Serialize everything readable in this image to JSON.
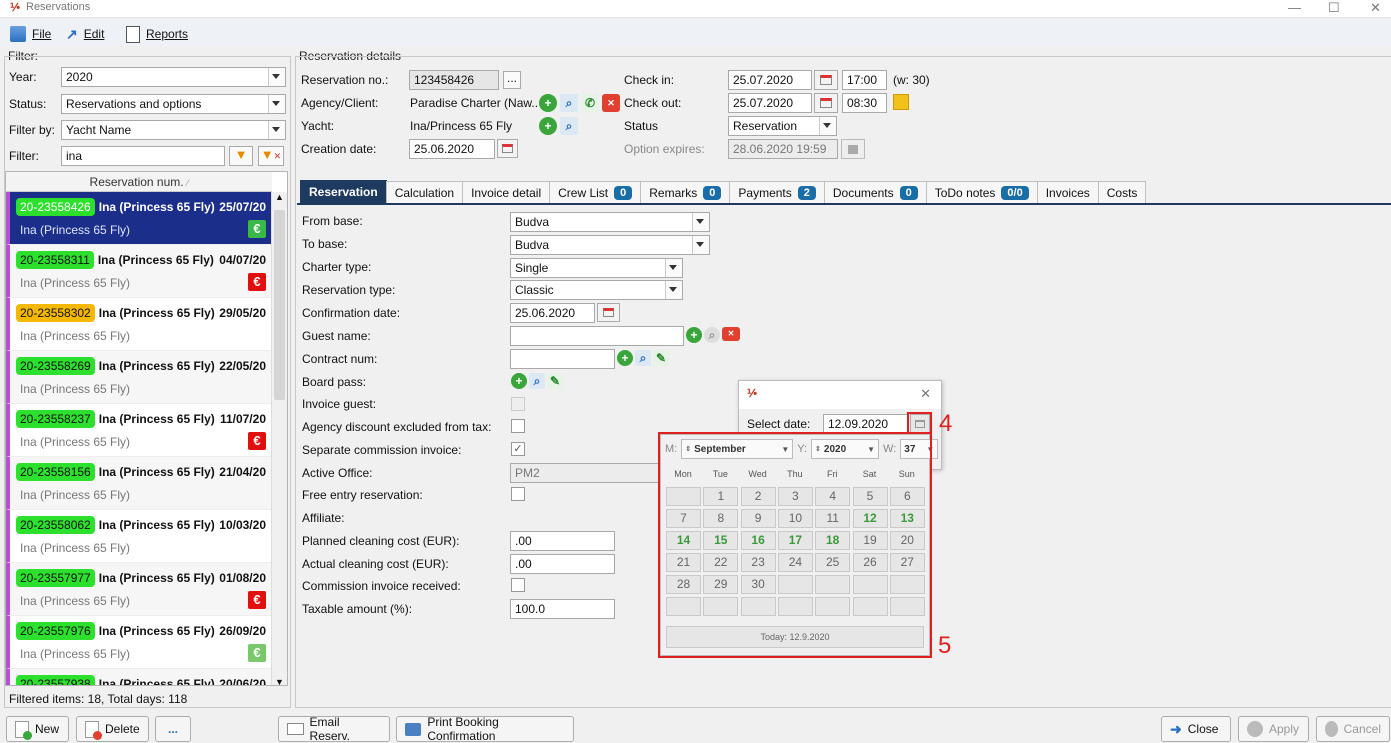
{
  "window": {
    "title": "Reservations"
  },
  "menu": {
    "file": "File",
    "edit": "Edit",
    "reports": "Reports"
  },
  "filter": {
    "group": "Filter:",
    "year_label": "Year:",
    "year": "2020",
    "status_label": "Status:",
    "status": "Reservations and options",
    "filterby_label": "Filter by:",
    "filterby": "Yacht Name",
    "filter_label": "Filter:",
    "filter_value": "ina",
    "column": "Reservation num.",
    "footer": "Filtered items: 18, Total days: 118"
  },
  "reservations": [
    {
      "num": "20-23558426",
      "yacht": "Ina (Princess 65 Fly)",
      "date": "25/07/20",
      "sub": "Ina (Princess 65 Fly)",
      "tag": "green",
      "pay": "€",
      "paycolor": "#3bb84a",
      "selected": true
    },
    {
      "num": "20-23558311",
      "yacht": "Ina (Princess 65 Fly)",
      "date": "04/07/20",
      "sub": "Ina (Princess 65 Fly)",
      "tag": "green",
      "pay": "€",
      "paycolor": "#e01010"
    },
    {
      "num": "20-23558302",
      "yacht": "Ina (Princess 65 Fly)",
      "date": "29/05/20",
      "sub": "Ina (Princess 65 Fly)",
      "tag": "orange",
      "pay": "",
      "paycolor": ""
    },
    {
      "num": "20-23558269",
      "yacht": "Ina (Princess 65 Fly)",
      "date": "22/05/20",
      "sub": "Ina (Princess 65 Fly)",
      "tag": "green",
      "pay": "",
      "paycolor": ""
    },
    {
      "num": "20-23558237",
      "yacht": "Ina (Princess 65 Fly)",
      "date": "11/07/20",
      "sub": "Ina (Princess 65 Fly)",
      "tag": "green",
      "pay": "€",
      "paycolor": "#e01010"
    },
    {
      "num": "20-23558156",
      "yacht": "Ina (Princess 65 Fly)",
      "date": "21/04/20",
      "sub": "Ina (Princess 65 Fly)",
      "tag": "green",
      "pay": "",
      "paycolor": ""
    },
    {
      "num": "20-23558062",
      "yacht": "Ina (Princess 65 Fly)",
      "date": "10/03/20",
      "sub": "Ina (Princess 65 Fly)",
      "tag": "green",
      "pay": "",
      "paycolor": ""
    },
    {
      "num": "20-23557977",
      "yacht": "Ina (Princess 65 Fly)",
      "date": "01/08/20",
      "sub": "Ina (Princess 65 Fly)",
      "tag": "green",
      "pay": "€",
      "paycolor": "#e01010"
    },
    {
      "num": "20-23557976",
      "yacht": "Ina (Princess 65 Fly)",
      "date": "26/09/20",
      "sub": "Ina (Princess 65 Fly)",
      "tag": "green",
      "pay": "€",
      "paycolor": "#7bc86c"
    },
    {
      "num": "20-23557938",
      "yacht": "Ina (Princess 65 Fly)",
      "date": "20/06/20",
      "sub": "",
      "tag": "green",
      "pay": "",
      "paycolor": ""
    }
  ],
  "details": {
    "group": "Reservation details",
    "resno_label": "Reservation no.:",
    "resno": "123458426",
    "agency_label": "Agency/Client:",
    "agency": "Paradise Charter (Naw...",
    "yacht_label": "Yacht:",
    "yacht": "Ina/Princess 65 Fly",
    "creation_label": "Creation date:",
    "creation": "25.06.2020",
    "checkin_label": "Check in:",
    "checkin_date": "25.07.2020",
    "checkin_time": "17:00",
    "week": "(w: 30)",
    "checkout_label": "Check out:",
    "checkout_date": "25.07.2020",
    "checkout_time": "08:30",
    "status_label": "Status",
    "status": "Reservation",
    "option_label": "Option expires:",
    "option": "28.06.2020 19:59"
  },
  "tabs": [
    {
      "label": "Reservation"
    },
    {
      "label": "Calculation"
    },
    {
      "label": "Invoice detail"
    },
    {
      "label": "Crew List",
      "badge": "0"
    },
    {
      "label": "Remarks",
      "badge": "0"
    },
    {
      "label": "Payments",
      "badge": "2"
    },
    {
      "label": "Documents",
      "badge": "0"
    },
    {
      "label": "ToDo notes",
      "badge": "0/0"
    },
    {
      "label": "Invoices"
    },
    {
      "label": "Costs"
    }
  ],
  "form": {
    "from_base_label": "From base:",
    "from_base": "Budva",
    "to_base_label": "To base:",
    "to_base": "Budva",
    "charter_label": "Charter type:",
    "charter": "Single",
    "restype_label": "Reservation type:",
    "restype": "Classic",
    "confdate_label": "Confirmation date:",
    "confdate": "25.06.2020",
    "guest_label": "Guest name:",
    "contract_label": "Contract num:",
    "board_label": "Board pass:",
    "invguest_label": "Invoice guest:",
    "agency_disc_label": "Agency discount excluded from tax:",
    "sep_comm_label": "Separate commission invoice:",
    "office_label": "Active Office:",
    "office": "PM2",
    "free_label": "Free entry reservation:",
    "affiliate_label": "Affiliate:",
    "planned_label": "Planned cleaning cost (EUR):",
    "planned": ".00",
    "actual_label": "Actual cleaning cost (EUR):",
    "actual": ".00",
    "comm_recv_label": "Commission invoice received:",
    "taxable_label": "Taxable amount (%):",
    "taxable": "100.0"
  },
  "dialog": {
    "select_label": "Select date:",
    "select_value": "12.09.2020"
  },
  "calendar": {
    "m_label": "M:",
    "month": "September",
    "y_label": "Y:",
    "year": "2020",
    "w_label": "W:",
    "week": "37",
    "daynames": [
      "Mon",
      "Tue",
      "Wed",
      "Thu",
      "Fri",
      "Sat",
      "Sun"
    ],
    "rows": [
      [
        "",
        "1",
        "2",
        "3",
        "4",
        "5",
        "6"
      ],
      [
        "7",
        "8",
        "9",
        "10",
        "11",
        "12",
        "13"
      ],
      [
        "14",
        "15",
        "16",
        "17",
        "18",
        "19",
        "20"
      ],
      [
        "21",
        "22",
        "23",
        "24",
        "25",
        "26",
        "27"
      ],
      [
        "28",
        "29",
        "30",
        "",
        "",
        "",
        ""
      ],
      [
        "",
        "",
        "",
        "",
        "",
        "",
        ""
      ]
    ],
    "highlight": [
      "12",
      "13",
      "14",
      "15",
      "16",
      "17",
      "18"
    ],
    "today": "Today: 12.9.2020"
  },
  "annotations": {
    "a4": "4",
    "a5": "5"
  },
  "buttons": {
    "new": "New",
    "delete": "Delete",
    "more": "...",
    "email": "Email Reserv.",
    "print": "Print Booking Confirmation",
    "close": "Close",
    "apply": "Apply",
    "cancel": "Cancel"
  }
}
